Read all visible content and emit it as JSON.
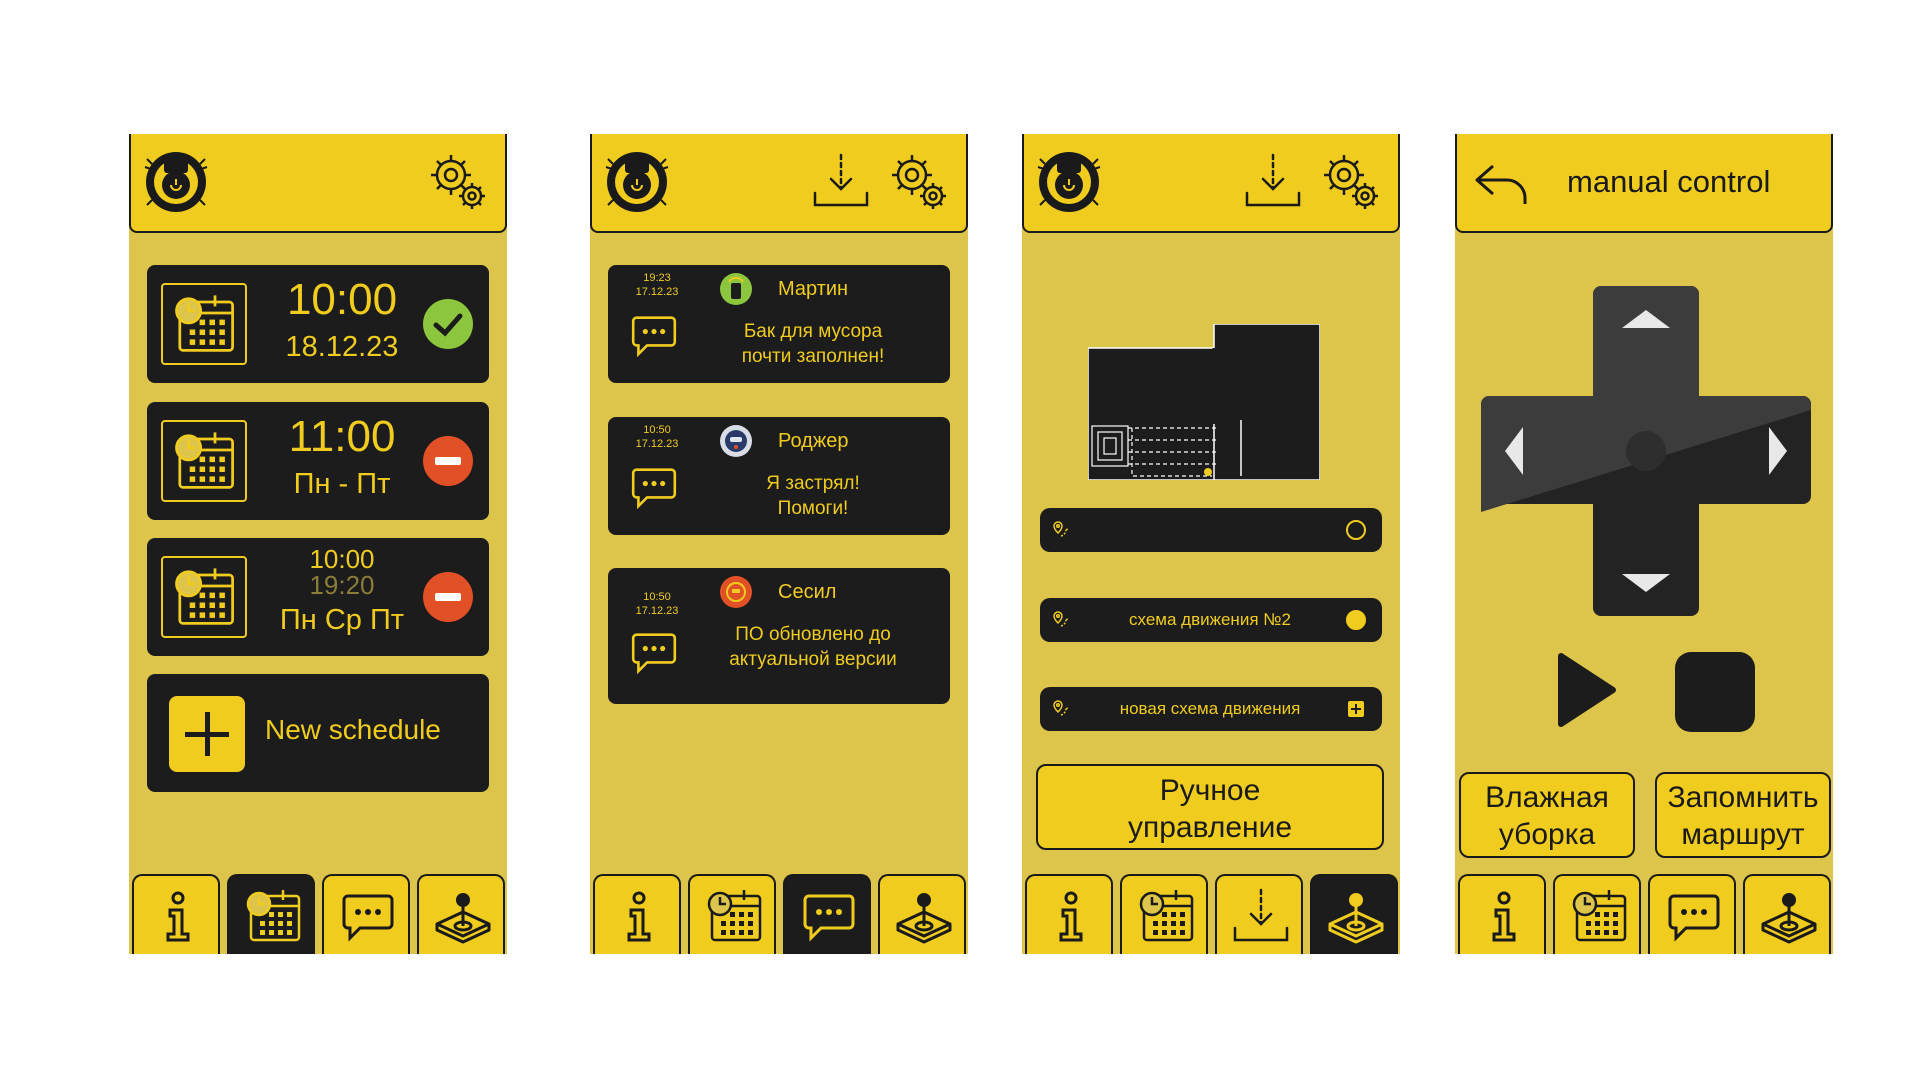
{
  "colors": {
    "accent": "#f0cc1e",
    "panel": "#ddc44a",
    "card": "#1c1c1c",
    "ok": "#8cc63e",
    "remove": "#e25026"
  },
  "tabbar": [
    {
      "icon": "info-icon"
    },
    {
      "icon": "calendar-clock-icon"
    },
    {
      "icon": "chat-icon"
    },
    {
      "icon": "joystick-icon"
    }
  ],
  "schedule_screen": {
    "active_tab": 1,
    "items": [
      {
        "time": "10:00",
        "date": "18.12.23",
        "status": "check-icon"
      },
      {
        "time": "11:00",
        "days": "Пн - Пт",
        "status": "remove-icon"
      },
      {
        "time": "10:00",
        "time2": "19:20",
        "days": "Пн Ср Пт",
        "status": "remove-icon"
      }
    ],
    "new_label": "New schedule"
  },
  "messages_screen": {
    "active_tab": 2,
    "items": [
      {
        "time": "19:23",
        "date": "17.12.23",
        "name": "Мартин",
        "text1": "Бак для мусора",
        "text2": "почти заполнен!"
      },
      {
        "time": "10:50",
        "date": "17.12.23",
        "name": "Роджер",
        "text1": "Я застрял!",
        "text2": "Помоги!"
      },
      {
        "time": "10:50",
        "date": "17.12.23",
        "name": "Сесил",
        "text1": "ПО обновлено до",
        "text2": "актуальной версии"
      }
    ]
  },
  "routes_screen": {
    "active_tab": 3,
    "routes": [
      {
        "label": "",
        "selected": false
      },
      {
        "label": "схема движения №2",
        "selected": true
      },
      {
        "label": "новая схема движения",
        "action": "plus"
      }
    ],
    "manual_btn_line1": "Ручное",
    "manual_btn_line2": "управление"
  },
  "manual_screen": {
    "title": "manual control",
    "wet_line1": "Влажная",
    "wet_line2": "уборка",
    "mem_line1": "Запомнить",
    "mem_line2": "маршрут"
  }
}
